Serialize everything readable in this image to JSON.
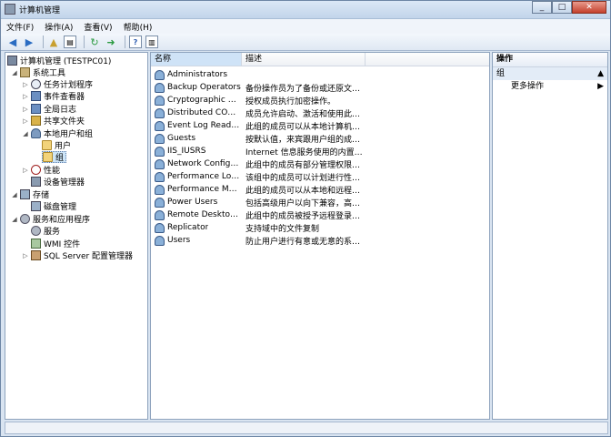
{
  "window": {
    "title": "计算机管理"
  },
  "menu": [
    "文件(F)",
    "操作(A)",
    "查看(V)",
    "帮助(H)"
  ],
  "tree": {
    "root": "计算机管理 (TESTPC01)",
    "system_tools": "系统工具",
    "task_scheduler": "任务计划程序",
    "event_viewer": "事件查看器",
    "shared_folders": "共享文件夹",
    "local_users_groups": "本地用户和组",
    "users": "用户",
    "groups": "组",
    "performance": "性能",
    "device_manager": "设备管理器",
    "storage": "存储",
    "disk_management": "磁盘管理",
    "services_apps": "服务和应用程序",
    "services": "服务",
    "wmi": "WMI 控件",
    "sql_config": "SQL Server 配置管理器",
    "global_log": "全局日志"
  },
  "list": {
    "columns": {
      "name": "名称",
      "description": "描述"
    },
    "rows": [
      {
        "name": "Administrators",
        "desc": ""
      },
      {
        "name": "Backup Operators",
        "desc": "备份操作员为了备份或还原文件..."
      },
      {
        "name": "Cryptographic Oper...",
        "desc": "授权成员执行加密操作。"
      },
      {
        "name": "Distributed COM Us...",
        "desc": "成员允许启动、激活和使用此计..."
      },
      {
        "name": "Event Log Readers",
        "desc": "此组的成员可以从本地计算机中..."
      },
      {
        "name": "Guests",
        "desc": "按默认值，来宾跟用户组的成员..."
      },
      {
        "name": "IIS_IUSRS",
        "desc": "Internet 信息服务使用的内置组。"
      },
      {
        "name": "Network Configurat...",
        "desc": "此组中的成员有部分管理权限来..."
      },
      {
        "name": "Performance Log U...",
        "desc": "该组中的成员可以计划进行性能..."
      },
      {
        "name": "Performance Monit...",
        "desc": "此组的成员可以从本地和远程访..."
      },
      {
        "name": "Power Users",
        "desc": "包括高级用户以向下兼容，高级..."
      },
      {
        "name": "Remote Desktop Us...",
        "desc": "此组中的成员被授予远程登录的..."
      },
      {
        "name": "Replicator",
        "desc": "支持域中的文件复制"
      },
      {
        "name": "Users",
        "desc": "防止用户进行有意或无意的系统..."
      }
    ]
  },
  "actions": {
    "header": "操作",
    "group": "组",
    "more": "更多操作"
  }
}
